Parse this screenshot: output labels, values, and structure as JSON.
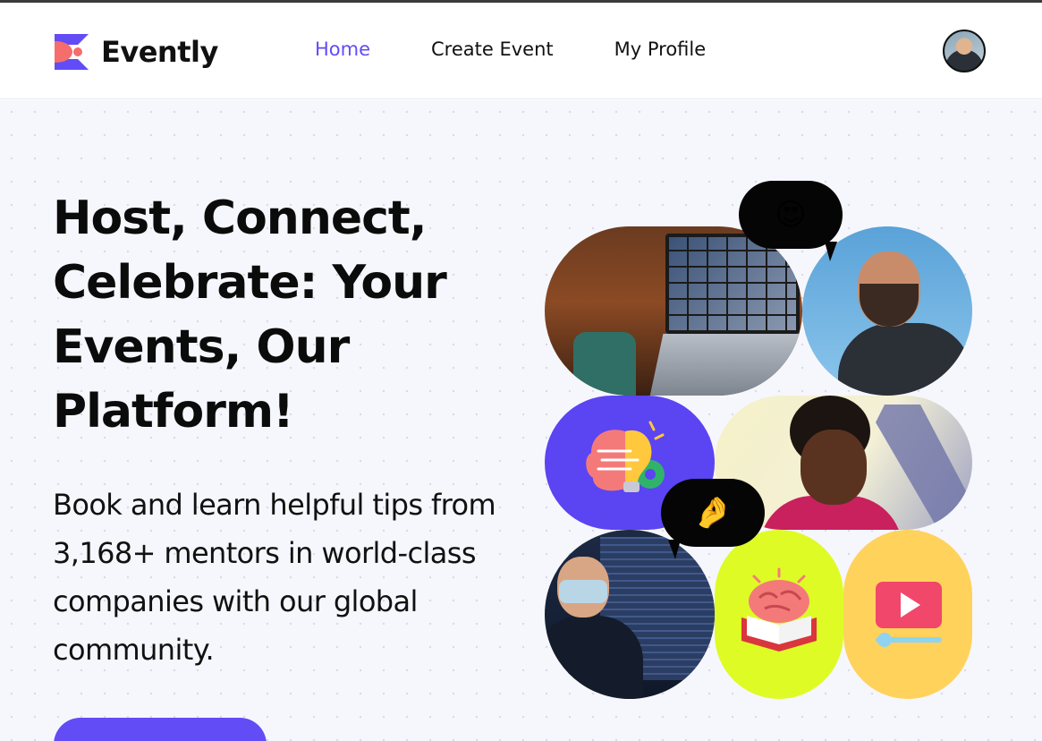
{
  "brand": {
    "name": "Evently",
    "accent_color": "#624cf5"
  },
  "nav": {
    "items": [
      {
        "label": "Home",
        "active": true
      },
      {
        "label": "Create Event",
        "active": false
      },
      {
        "label": "My Profile",
        "active": false
      }
    ]
  },
  "user": {
    "avatar_icon": "user-avatar"
  },
  "hero": {
    "title": "Host, Connect, Celebrate: Your Events, Our Platform!",
    "subtitle": "Book and learn helpful tips from 3,168+ mentors in world-class companies with our global community."
  },
  "collage": {
    "heart_bubble_emoji": "😍",
    "pinch_bubble_emoji": "🤌",
    "tile_icons": [
      "laptop-video-call-photo",
      "smiling-man-photo",
      "brain-lightbulb-icon",
      "laughing-woman-photo",
      "teacher-photo",
      "brain-book-icon",
      "video-player-icon"
    ]
  }
}
